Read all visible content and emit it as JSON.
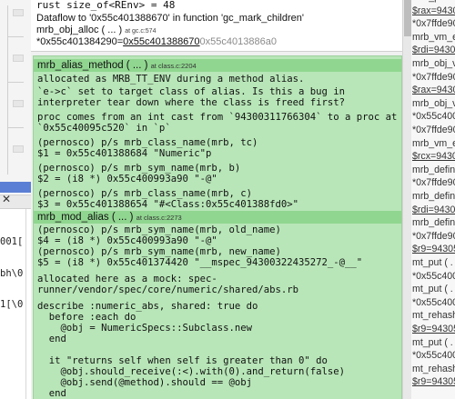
{
  "left_code_fragments": [
    "001[",
    "bh\\0",
    "1[\\0"
  ],
  "top_card": {
    "line1": "rust size_of<REnv> = 48",
    "line2": "Dataflow to '0x55c401388670' in function 'gc_mark_children'",
    "line3_name": "mrb_obj_alloc ( ... )",
    "line3_at": "at gc.c:574",
    "line4_prefix": "*0x55c401384290=",
    "line4_value": "0x55c401388670",
    "line4_faded": "0x55c4013886a0"
  },
  "card1": {
    "title": "mrb_alias_method ( ... )",
    "at": "at class.c:2204",
    "lines": [
      "allocated as MRB_TT_ENV during a method alias.",
      "`e->c` set to target class of alias. Is this a bug in",
      "interpreter tear down where the class is freed first?",
      "proc comes from an int cast from `94300311766304` to a proc at",
      "`0x55c40095c520` in `p`",
      "(pernosco) p/s mrb_class_name(mrb, tc)",
      "$1 = 0x55c401388684 \"Numeric\"p",
      "(pernosco) p/s mrb_sym_name(mrb, b)",
      "$2 = (i8 *) 0x55c400993a90 \"-@\"",
      "(pernosco) p/s mrb_class_name(mrb, c)",
      "$3 = 0x55c401388654 \"#<Class:0x55c401388fd0>\""
    ]
  },
  "card2": {
    "title": "mrb_mod_alias ( ... )",
    "at": "at class.c:2273",
    "lines": [
      "(pernosco) p/s mrb_sym_name(mrb, old_name)",
      "$4 = (i8 *) 0x55c400993a90 \"-@\"",
      "(pernosco) p/s mrb_sym_name(mrb, new_name)",
      "$5 = (i8 *) 0x55c401374420 \"__mspec_94300322435272_-@__\"",
      "allocated here as a mock: spec-",
      "runner/vendor/spec/core/numeric/shared/abs.rb",
      "describe :numeric_abs, shared: true do",
      "  before :each do",
      "    @obj = NumericSpecs::Subclass.new",
      "  end",
      "  it \"returns self when self is greater than 0\" do",
      "    @obj.should_receive(:<).with(0).and_return(false)",
      "    @obj.send(@method).should == @obj",
      "  end"
    ]
  },
  "right_panel": [
    "mrb_push",
    "$rax=94300",
    "*0x7ffde90",
    "mrb_vm_e",
    "$rdi=94300",
    "mrb_obj_v",
    "*0x7ffde90",
    "$rax=94300",
    "mrb_obj_v",
    "*0x55c400",
    "*0x7ffde90",
    "mrb_vm_e",
    "$rcx=94300",
    "mrb_defin",
    "*0x7ffde90",
    "mrb_defin",
    "$rdi=94300",
    "mrb_defin",
    "*0x7ffde90",
    "$r9=94305",
    "mt_put ( .",
    "*0x55c400",
    "mt_put ( .",
    "*0x55c400",
    "mt_rehash",
    "$r9=94305",
    "mt_put ( .",
    "*0x55c400",
    "mt_rehash",
    "$r9=94305"
  ],
  "right_underlined": [
    1,
    4,
    7,
    12,
    16,
    19,
    25,
    29
  ]
}
